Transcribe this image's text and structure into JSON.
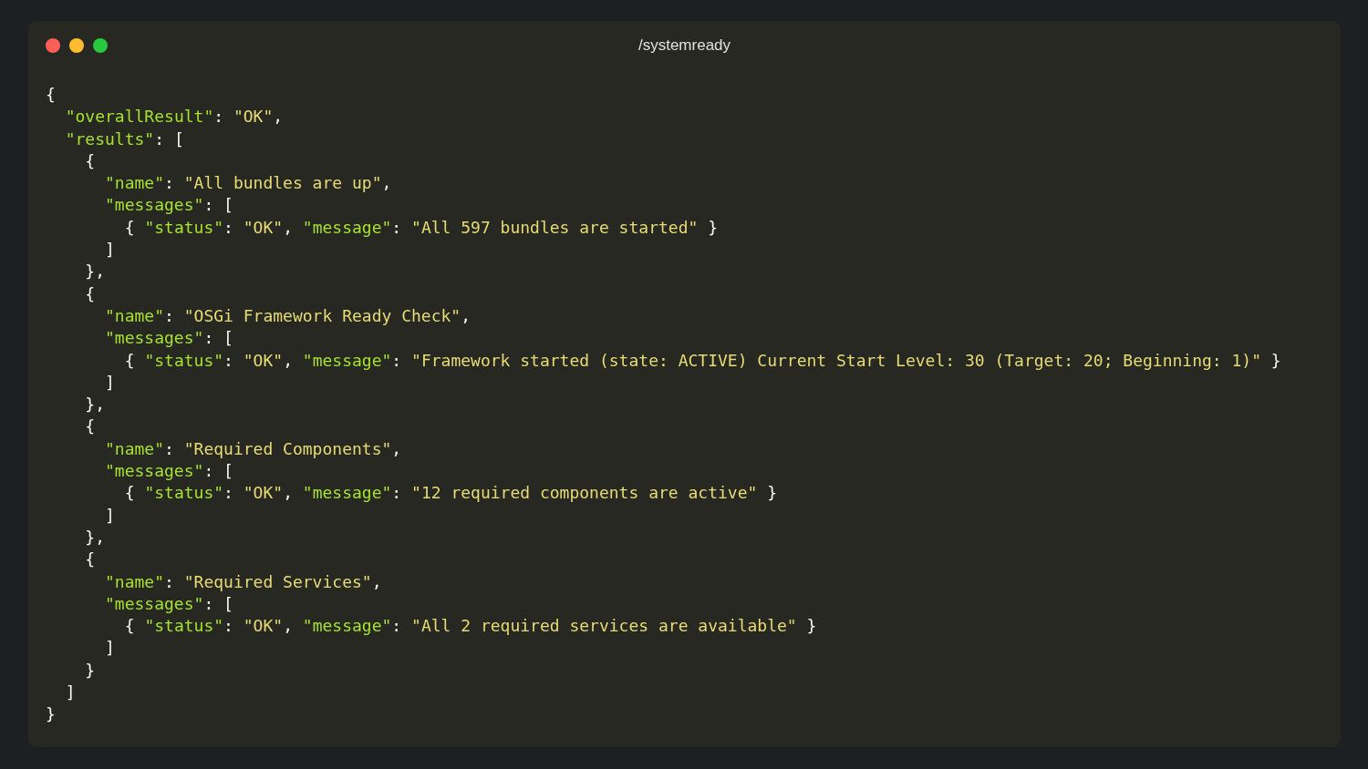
{
  "window": {
    "title": "/systemready"
  },
  "code": [
    {
      "tokens": [
        {
          "kind": "punct",
          "text": "{"
        }
      ],
      "children": [
        {
          "tokens": [
            {
              "kind": "key",
              "text": "\"overallResult\""
            },
            {
              "kind": "punct",
              "text": ": "
            },
            {
              "kind": "string",
              "text": "\"OK\""
            },
            {
              "kind": "punct",
              "text": ","
            }
          ]
        },
        {
          "tokens": [
            {
              "kind": "key",
              "text": "\"results\""
            },
            {
              "kind": "punct",
              "text": ": ["
            }
          ],
          "children": [
            {
              "tokens": [
                {
                  "kind": "punct",
                  "text": "{"
                }
              ],
              "children": [
                {
                  "tokens": [
                    {
                      "kind": "key",
                      "text": "\"name\""
                    },
                    {
                      "kind": "punct",
                      "text": ": "
                    },
                    {
                      "kind": "string",
                      "text": "\"All bundles are up\""
                    },
                    {
                      "kind": "punct",
                      "text": ","
                    }
                  ]
                },
                {
                  "tokens": [
                    {
                      "kind": "key",
                      "text": "\"messages\""
                    },
                    {
                      "kind": "punct",
                      "text": ": ["
                    }
                  ],
                  "children": [
                    {
                      "tokens": [
                        {
                          "kind": "punct",
                          "text": "{ "
                        },
                        {
                          "kind": "key",
                          "text": "\"status\""
                        },
                        {
                          "kind": "punct",
                          "text": ": "
                        },
                        {
                          "kind": "string",
                          "text": "\"OK\""
                        },
                        {
                          "kind": "punct",
                          "text": ", "
                        },
                        {
                          "kind": "key",
                          "text": "\"message\""
                        },
                        {
                          "kind": "punct",
                          "text": ": "
                        },
                        {
                          "kind": "string",
                          "text": "\"All 597 bundles are started\""
                        },
                        {
                          "kind": "punct",
                          "text": " }"
                        }
                      ]
                    }
                  ]
                },
                {
                  "tokens": [
                    {
                      "kind": "punct",
                      "text": "]"
                    }
                  ]
                }
              ]
            },
            {
              "tokens": [
                {
                  "kind": "punct",
                  "text": "},"
                }
              ]
            },
            {
              "tokens": [
                {
                  "kind": "punct",
                  "text": "{"
                }
              ],
              "children": [
                {
                  "tokens": [
                    {
                      "kind": "key",
                      "text": "\"name\""
                    },
                    {
                      "kind": "punct",
                      "text": ": "
                    },
                    {
                      "kind": "string",
                      "text": "\"OSGi Framework Ready Check\""
                    },
                    {
                      "kind": "punct",
                      "text": ","
                    }
                  ]
                },
                {
                  "tokens": [
                    {
                      "kind": "key",
                      "text": "\"messages\""
                    },
                    {
                      "kind": "punct",
                      "text": ": ["
                    }
                  ],
                  "children": [
                    {
                      "tokens": [
                        {
                          "kind": "punct",
                          "text": "{ "
                        },
                        {
                          "kind": "key",
                          "text": "\"status\""
                        },
                        {
                          "kind": "punct",
                          "text": ": "
                        },
                        {
                          "kind": "string",
                          "text": "\"OK\""
                        },
                        {
                          "kind": "punct",
                          "text": ", "
                        },
                        {
                          "kind": "key",
                          "text": "\"message\""
                        },
                        {
                          "kind": "punct",
                          "text": ": "
                        },
                        {
                          "kind": "string",
                          "text": "\"Framework started (state: ACTIVE) Current Start Level: 30 (Target: 20; Beginning: 1)\""
                        },
                        {
                          "kind": "punct",
                          "text": " }"
                        }
                      ]
                    }
                  ]
                },
                {
                  "tokens": [
                    {
                      "kind": "punct",
                      "text": "]"
                    }
                  ]
                }
              ]
            },
            {
              "tokens": [
                {
                  "kind": "punct",
                  "text": "},"
                }
              ]
            },
            {
              "tokens": [
                {
                  "kind": "punct",
                  "text": "{"
                }
              ],
              "children": [
                {
                  "tokens": [
                    {
                      "kind": "key",
                      "text": "\"name\""
                    },
                    {
                      "kind": "punct",
                      "text": ": "
                    },
                    {
                      "kind": "string",
                      "text": "\"Required Components\""
                    },
                    {
                      "kind": "punct",
                      "text": ","
                    }
                  ]
                },
                {
                  "tokens": [
                    {
                      "kind": "key",
                      "text": "\"messages\""
                    },
                    {
                      "kind": "punct",
                      "text": ": ["
                    }
                  ],
                  "children": [
                    {
                      "tokens": [
                        {
                          "kind": "punct",
                          "text": "{ "
                        },
                        {
                          "kind": "key",
                          "text": "\"status\""
                        },
                        {
                          "kind": "punct",
                          "text": ": "
                        },
                        {
                          "kind": "string",
                          "text": "\"OK\""
                        },
                        {
                          "kind": "punct",
                          "text": ", "
                        },
                        {
                          "kind": "key",
                          "text": "\"message\""
                        },
                        {
                          "kind": "punct",
                          "text": ": "
                        },
                        {
                          "kind": "string",
                          "text": "\"12 required components are active\""
                        },
                        {
                          "kind": "punct",
                          "text": " }"
                        }
                      ]
                    }
                  ]
                },
                {
                  "tokens": [
                    {
                      "kind": "punct",
                      "text": "]"
                    }
                  ]
                }
              ]
            },
            {
              "tokens": [
                {
                  "kind": "punct",
                  "text": "},"
                }
              ]
            },
            {
              "tokens": [
                {
                  "kind": "punct",
                  "text": "{"
                }
              ],
              "children": [
                {
                  "tokens": [
                    {
                      "kind": "key",
                      "text": "\"name\""
                    },
                    {
                      "kind": "punct",
                      "text": ": "
                    },
                    {
                      "kind": "string",
                      "text": "\"Required Services\""
                    },
                    {
                      "kind": "punct",
                      "text": ","
                    }
                  ]
                },
                {
                  "tokens": [
                    {
                      "kind": "key",
                      "text": "\"messages\""
                    },
                    {
                      "kind": "punct",
                      "text": ": ["
                    }
                  ],
                  "children": [
                    {
                      "tokens": [
                        {
                          "kind": "punct",
                          "text": "{ "
                        },
                        {
                          "kind": "key",
                          "text": "\"status\""
                        },
                        {
                          "kind": "punct",
                          "text": ": "
                        },
                        {
                          "kind": "string",
                          "text": "\"OK\""
                        },
                        {
                          "kind": "punct",
                          "text": ", "
                        },
                        {
                          "kind": "key",
                          "text": "\"message\""
                        },
                        {
                          "kind": "punct",
                          "text": ": "
                        },
                        {
                          "kind": "string",
                          "text": "\"All 2 required services are available\""
                        },
                        {
                          "kind": "punct",
                          "text": " }"
                        }
                      ]
                    }
                  ]
                },
                {
                  "tokens": [
                    {
                      "kind": "punct",
                      "text": "]"
                    }
                  ]
                }
              ]
            },
            {
              "tokens": [
                {
                  "kind": "punct",
                  "text": "}"
                }
              ]
            }
          ]
        },
        {
          "tokens": [
            {
              "kind": "punct",
              "text": "]"
            }
          ]
        }
      ]
    },
    {
      "tokens": [
        {
          "kind": "punct",
          "text": "}"
        }
      ]
    }
  ]
}
